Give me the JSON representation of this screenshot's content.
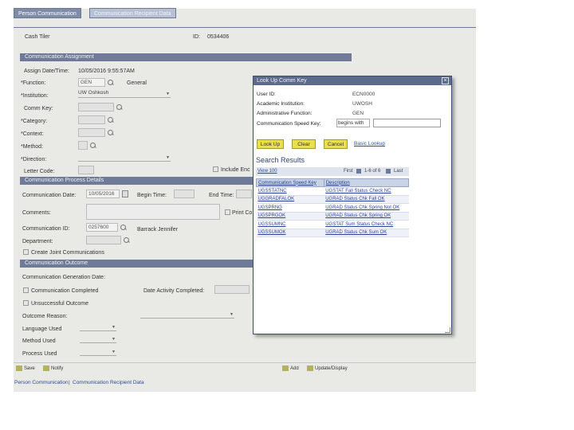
{
  "tabs": [
    {
      "label": "Person Communication"
    },
    {
      "label": "Communication Recipient Data"
    }
  ],
  "header": {
    "name_label": "Cash Tiler",
    "id_label": "ID:",
    "id_value": "0534406"
  },
  "comm_assignment": {
    "section_title": "Communication Assignment",
    "assign_datetime_label": "Assign Date/Time:",
    "assign_datetime_value": "10/05/2016 9:55:57AM",
    "function_label": "*Function:",
    "function_value": "GEN",
    "function_desc": "General",
    "institution_label": "*Institution:",
    "institution_value": "UW Oshkosh",
    "comm_key_label": "Comm Key:",
    "category_label": "*Category:",
    "context_label": "*Context:",
    "method_label": "*Method:",
    "direction_label": "*Direction:",
    "letter_code_label": "Letter Code:",
    "include_enc_label": "Include Enc"
  },
  "process_details": {
    "section_title": "Communication Process Details",
    "comm_date_label": "Communication Date:",
    "comm_date_value": "10/05/2016",
    "begin_time_label": "Begin Time:",
    "end_time_label": "End Time:",
    "comments_label": "Comments:",
    "print_comm_label": "Print Co",
    "comm_id_label": "Communication ID:",
    "comm_id_value": "0257600",
    "comm_id_desc": "Barrack Jennifer",
    "department_label": "Department:",
    "joint_comm_label": "Create Joint Communications"
  },
  "outcome": {
    "section_title": "Communication Outcome",
    "gen_date_label": "Communication Generation Date:",
    "completed_label": "Communication Completed",
    "date_completed_label": "Date Activity Completed:",
    "unsuccessful_label": "Unsuccessful Outcome",
    "outcome_reason_label": "Outcome Reason:",
    "language_label": "Language Used",
    "method_used_label": "Method Used",
    "process_used_label": "Process Used"
  },
  "bottom_bar": {
    "save_label": "Save",
    "notify_label": "Notify",
    "add_label": "Add",
    "update_label": "Update/Display"
  },
  "footer": {
    "link1": "Person Communication",
    "separator": "|",
    "link2": "Communication Recipient Data"
  },
  "modal": {
    "title": "Look Up Comm Key",
    "close_icon": "close-icon",
    "user_id_label": "User ID:",
    "user_id_value": "ECN0000",
    "institution_label": "Academic Institution:",
    "institution_value": "UWOSH",
    "admin_function_label": "Administrative Function:",
    "admin_function_value": "GEN",
    "speed_key_label": "Communication Speed Key:",
    "speed_key_operator": "begins with",
    "speed_key_value": "",
    "lookup_button": "Look Up",
    "clear_button": "Clear",
    "cancel_button": "Cancel",
    "basic_lookup_link": "Basic Lookup",
    "results_title": "Search Results",
    "view_all": "View 100",
    "nav_first": "First",
    "nav_range": "1-6 of 6",
    "nav_last": "Last",
    "columns": [
      "Communication Speed Key",
      "Description"
    ],
    "rows": [
      {
        "key": "UGSSTATNC",
        "desc": "UGSTAT Fall Status Check NC"
      },
      {
        "key": "UGGRADFALOK",
        "desc": "UGRAD Status Chk Fall OK"
      },
      {
        "key": "UGSPRNG",
        "desc": "UGRAD Status Chk Spring Not OK"
      },
      {
        "key": "UGSPRGOK",
        "desc": "UGRAD Status Chk Spring OK"
      },
      {
        "key": "UGSSUMNC",
        "desc": "UGSTAT Sum Status Check NC"
      },
      {
        "key": "UGSSUMOK",
        "desc": "UGRAD Status Chk Sum OK"
      }
    ]
  }
}
